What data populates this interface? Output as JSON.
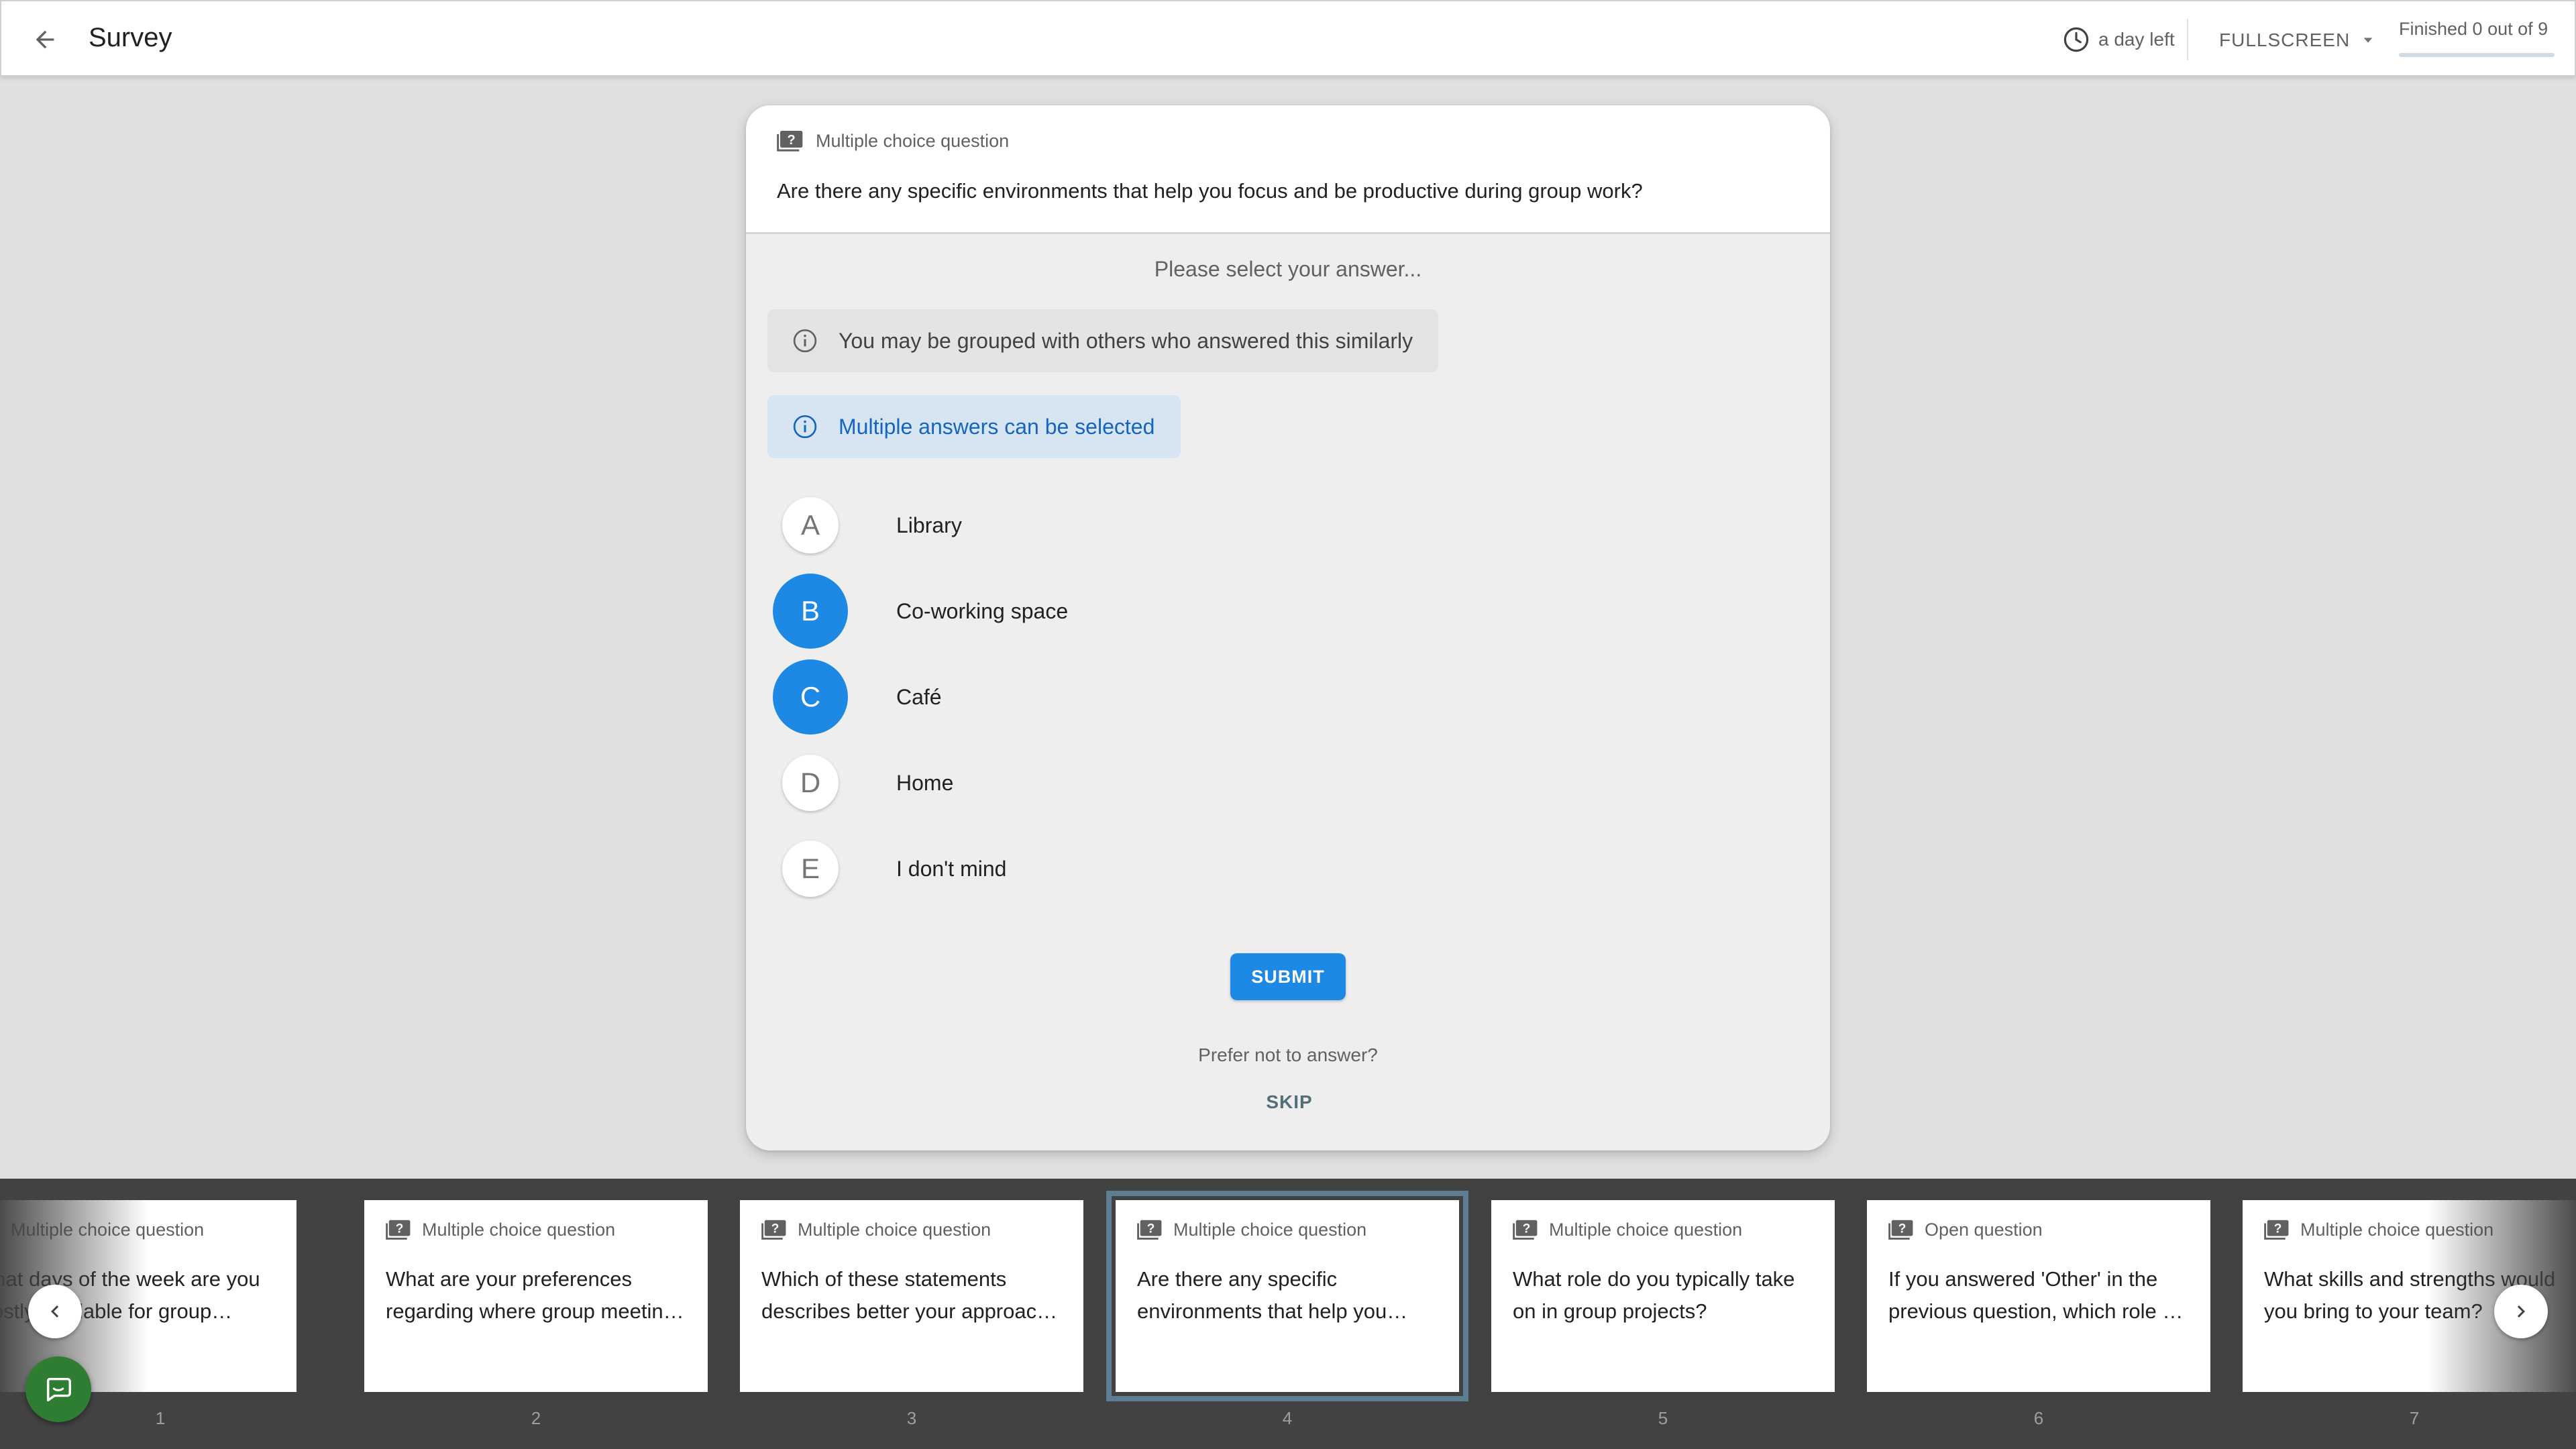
{
  "app": {
    "title": "Survey",
    "deadline": "a day left",
    "fullscreen_label": "FULLSCREEN",
    "progress_text": "Finished 0 out of 9",
    "progress_fraction": 0
  },
  "question": {
    "type_label": "Multiple choice question",
    "text": "Are there any specific environments that help you focus and be productive during group work?",
    "instruction": "Please select your answer...",
    "info_grouping": "You may be grouped with others who answered this similarly",
    "info_multiple": "Multiple answers can be selected",
    "options": [
      {
        "letter": "A",
        "label": "Library",
        "selected": false
      },
      {
        "letter": "B",
        "label": "Co-working space",
        "selected": true
      },
      {
        "letter": "C",
        "label": "Café",
        "selected": true
      },
      {
        "letter": "D",
        "label": "Home",
        "selected": false
      },
      {
        "letter": "E",
        "label": "I don't mind",
        "selected": false
      }
    ],
    "submit_label": "SUBMIT",
    "prefer_text": "Prefer not to answer?",
    "skip_label": "SKIP"
  },
  "carousel": {
    "current_index": 3,
    "items": [
      {
        "type": "Multiple choice question",
        "text": "What days of the week are you mostly available for group meetings?",
        "number": "1"
      },
      {
        "type": "Multiple choice question",
        "text": "What are your preferences regarding where group meetings are held?",
        "number": "2"
      },
      {
        "type": "Multiple choice question",
        "text": "Which of these statements describes better your approach to group work?",
        "number": "3"
      },
      {
        "type": "Multiple choice question",
        "text": "Are there any specific environments that help you focus and be productive during group work?",
        "number": "4"
      },
      {
        "type": "Multiple choice question",
        "text": "What role do you typically take on in group projects?",
        "number": "5"
      },
      {
        "type": "Open question",
        "text": "If you answered 'Other' in the previous question, which role do you take?",
        "number": "6"
      },
      {
        "type": "Multiple choice question",
        "text": "What skills and strengths would you bring to your team?",
        "number": "7"
      }
    ]
  },
  "colors": {
    "accent": "#1e88e5",
    "chat": "#2e7d32",
    "carousel_bg": "#424242",
    "info_blue_bg": "#d6e5f1"
  },
  "icons": {
    "back": "arrow-left-icon",
    "clock": "clock-icon",
    "dropdown": "caret-down-icon",
    "question_type": "question-card-icon",
    "info": "info-circle-icon",
    "prev": "chevron-left-icon",
    "next": "chevron-right-icon",
    "chat": "chat-bubble-icon"
  }
}
